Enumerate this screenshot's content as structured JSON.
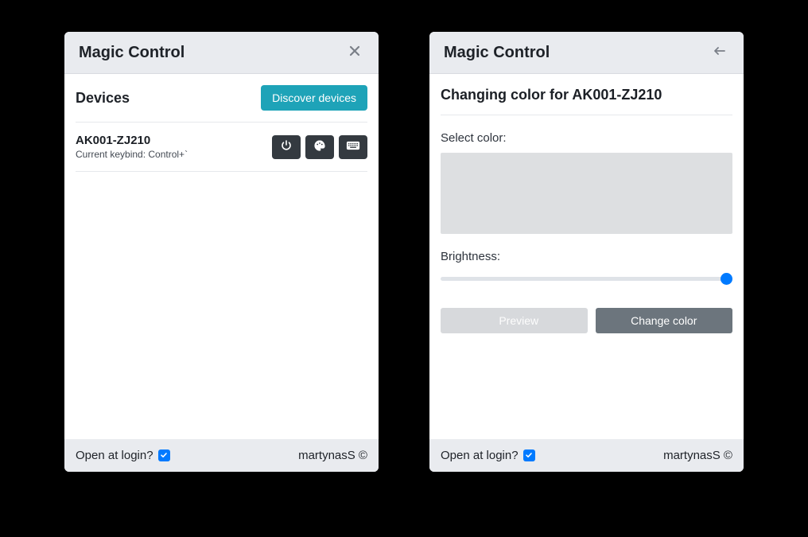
{
  "window1": {
    "title": "Magic Control",
    "section_title": "Devices",
    "discover_label": "Discover devices",
    "device": {
      "name": "AK001-ZJ210",
      "subtitle": "Current keybind: Control+`"
    }
  },
  "window2": {
    "title": "Magic Control",
    "heading": "Changing color for AK001-ZJ210",
    "select_color_label": "Select color:",
    "brightness_label": "Brightness:",
    "preview_label": "Preview",
    "change_label": "Change color"
  },
  "footer": {
    "open_at_login_label": "Open at login?",
    "open_at_login_checked": true,
    "credit": "martynasS ©"
  }
}
